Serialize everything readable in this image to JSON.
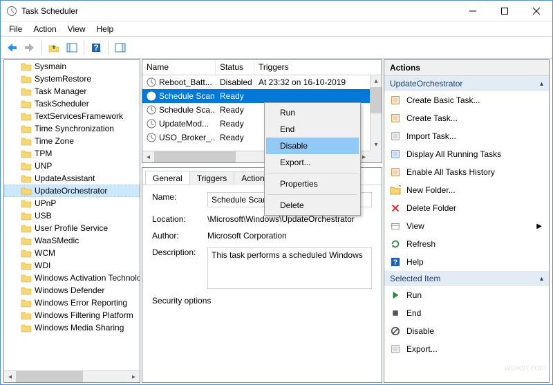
{
  "window": {
    "title": "Task Scheduler"
  },
  "menus": {
    "file": "File",
    "action": "Action",
    "view": "View",
    "help": "Help"
  },
  "tree": {
    "items": [
      {
        "label": "Sysmain",
        "selected": false
      },
      {
        "label": "SystemRestore",
        "selected": false
      },
      {
        "label": "Task Manager",
        "selected": false
      },
      {
        "label": "TaskScheduler",
        "selected": false
      },
      {
        "label": "TextServicesFramework",
        "selected": false
      },
      {
        "label": "Time Synchronization",
        "selected": false
      },
      {
        "label": "Time Zone",
        "selected": false
      },
      {
        "label": "TPM",
        "selected": false
      },
      {
        "label": "UNP",
        "selected": false
      },
      {
        "label": "UpdateAssistant",
        "selected": false
      },
      {
        "label": "UpdateOrchestrator",
        "selected": true
      },
      {
        "label": "UPnP",
        "selected": false
      },
      {
        "label": "USB",
        "selected": false
      },
      {
        "label": "User Profile Service",
        "selected": false
      },
      {
        "label": "WaaSMedic",
        "selected": false
      },
      {
        "label": "WCM",
        "selected": false
      },
      {
        "label": "WDI",
        "selected": false
      },
      {
        "label": "Windows Activation Technologies",
        "selected": false
      },
      {
        "label": "Windows Defender",
        "selected": false
      },
      {
        "label": "Windows Error Reporting",
        "selected": false
      },
      {
        "label": "Windows Filtering Platform",
        "selected": false
      },
      {
        "label": "Windows Media Sharing",
        "selected": false
      }
    ]
  },
  "tasks": {
    "headers": {
      "name": "Name",
      "status": "Status",
      "triggers": "Triggers"
    },
    "rows": [
      {
        "name": "Reboot_Batt...",
        "status": "Disabled",
        "triggers": "At 23:32 on 16-10-2019",
        "selected": false
      },
      {
        "name": "Schedule Scan",
        "status": "Ready",
        "triggers": "",
        "selected": true
      },
      {
        "name": "Schedule Sca...",
        "status": "Ready",
        "triggers": "",
        "selected": false
      },
      {
        "name": "UpdateMod...",
        "status": "Ready",
        "triggers": "",
        "selected": false
      },
      {
        "name": "USO_Broker_...",
        "status": "Ready",
        "triggers": "",
        "selected": false
      }
    ]
  },
  "context_menu": {
    "run": "Run",
    "end": "End",
    "disable": "Disable",
    "export": "Export...",
    "properties": "Properties",
    "delete": "Delete"
  },
  "details": {
    "tabs": {
      "general": "General",
      "triggers": "Triggers",
      "actions": "Actions"
    },
    "name_label": "Name:",
    "name_value": "Schedule Scan",
    "location_label": "Location:",
    "location_value": "\\Microsoft\\Windows\\UpdateOrchestrator",
    "author_label": "Author:",
    "author_value": "Microsoft Corporation",
    "description_label": "Description:",
    "description_value": "This task performs a scheduled Windows",
    "security_options": "Security options"
  },
  "actions_pane": {
    "header": "Actions",
    "group1_header": "UpdateOrchestrator",
    "group1_items": [
      {
        "icon": "create-basic-task-icon",
        "label": "Create Basic Task...",
        "color": "#c07000"
      },
      {
        "icon": "create-task-icon",
        "label": "Create Task...",
        "color": "#c07000"
      },
      {
        "icon": "import-task-icon",
        "label": "Import Task...",
        "color": "#888"
      },
      {
        "icon": "display-running-icon",
        "label": "Display All Running Tasks",
        "color": "#3a7abd"
      },
      {
        "icon": "enable-history-icon",
        "label": "Enable All Tasks History",
        "color": "#c07000"
      },
      {
        "icon": "new-folder-icon",
        "label": "New Folder...",
        "color": "#d4a017"
      },
      {
        "icon": "delete-folder-icon",
        "label": "Delete Folder",
        "color": "#d9322d"
      },
      {
        "icon": "view-icon",
        "label": "View",
        "color": "#888",
        "submenu": true
      },
      {
        "icon": "refresh-icon",
        "label": "Refresh",
        "color": "#2d8a3e"
      },
      {
        "icon": "help-icon",
        "label": "Help",
        "color": "#1e63b0"
      }
    ],
    "group2_header": "Selected Item",
    "group2_items": [
      {
        "icon": "run-icon",
        "label": "Run",
        "color": "#2d8a3e"
      },
      {
        "icon": "end-icon",
        "label": "End",
        "color": "#555"
      },
      {
        "icon": "disable-icon",
        "label": "Disable",
        "color": "#555"
      },
      {
        "icon": "export-icon",
        "label": "Export...",
        "color": "#888"
      }
    ]
  },
  "watermark": "wsxdn.com"
}
